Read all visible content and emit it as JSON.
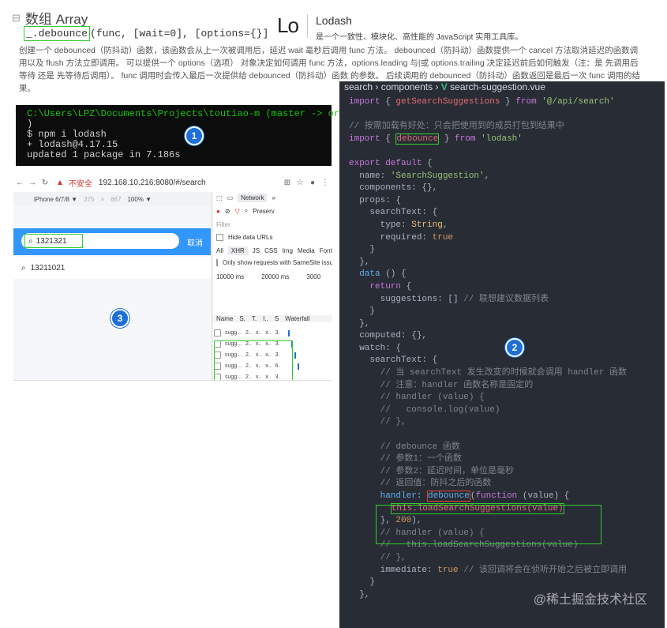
{
  "docs": {
    "collapse_icon": "⊟",
    "title": "数组 Array",
    "signature": {
      "name": "_.debounce",
      "params": "(func, [wait=0], [options={}])"
    },
    "description": "创建一个 debounced（防抖动）函数，该函数会从上一次被调用后，延迟 wait 毫秒后调用 func 方法。 debounced（防抖动）函数提供一个 cancel 方法取消延迟的函数调用以及 flush 方法立即调用。 可以提供一个 options（选项） 对象决定如何调用 func 方法，options.leading 与|或 options.trailing 决定延迟前后如何触发（注：是 先调用后等待 还是 先等待后调用）。 func 调用时会传入最后一次提供给 debounced（防抖动）函数 的参数。 后续调用的 debounced（防抖动）函数返回是最后一次 func 调用的结果。"
  },
  "lodash": {
    "logo": "Lo",
    "name": "Lodash",
    "tagline": "是一个一致性、模块化、高性能的 JavaScript 实用工具库。"
  },
  "terminal": {
    "prompt_line1": "C:\\Users\\LPZ\\Documents\\Projects\\toutiao-m (master -> origin",
    "prompt_line2": ")",
    "command": "$ npm i lodash",
    "out1": "+ lodash@4.17.15",
    "out2": "updated 1 package in 7.186s"
  },
  "steps": {
    "one": "1",
    "two": "2",
    "three": "3"
  },
  "browser": {
    "insecure": "不安全",
    "url": "192.168.10.216:8080/#/search",
    "device": "iPhone 6/7/8 ▼",
    "width": "375",
    "height": "667",
    "zoom": "100% ▼",
    "search_value": "1321321",
    "cancel": "取消",
    "suggestion": "13211021",
    "devtools": {
      "tab": "Network",
      "preserve": "Preserv",
      "filter": "Filter",
      "hide_data": "Hide data URLs",
      "types": [
        "All",
        "XHR",
        "JS",
        "CSS",
        "Img",
        "Media",
        "Font"
      ],
      "third_party": "Only show requests with SameSite issu",
      "timeline": [
        "10000 ms",
        "20000 ms",
        "3000"
      ],
      "columns": [
        "Name",
        "S.",
        "T.",
        "I..",
        "S",
        "Waterfall"
      ],
      "rows": [
        {
          "name": "sugg...",
          "s": "2..",
          "t": "x..",
          "i": "x..",
          "size": "3."
        },
        {
          "name": "sugg...",
          "s": "2..",
          "t": "x..",
          "i": "x..",
          "size": "3."
        },
        {
          "name": "sugg...",
          "s": "2..",
          "t": "x..",
          "i": "x..",
          "size": "3."
        },
        {
          "name": "sugg...",
          "s": "2..",
          "t": "x..",
          "i": "x..",
          "size": "6."
        },
        {
          "name": "sugg...",
          "s": "2..",
          "t": "x..",
          "i": "x..",
          "size": "3."
        }
      ]
    }
  },
  "editor": {
    "breadcrumb": [
      "search",
      "components",
      "search-suggestion.vue"
    ],
    "watermark": "@稀土掘金技术社区"
  }
}
